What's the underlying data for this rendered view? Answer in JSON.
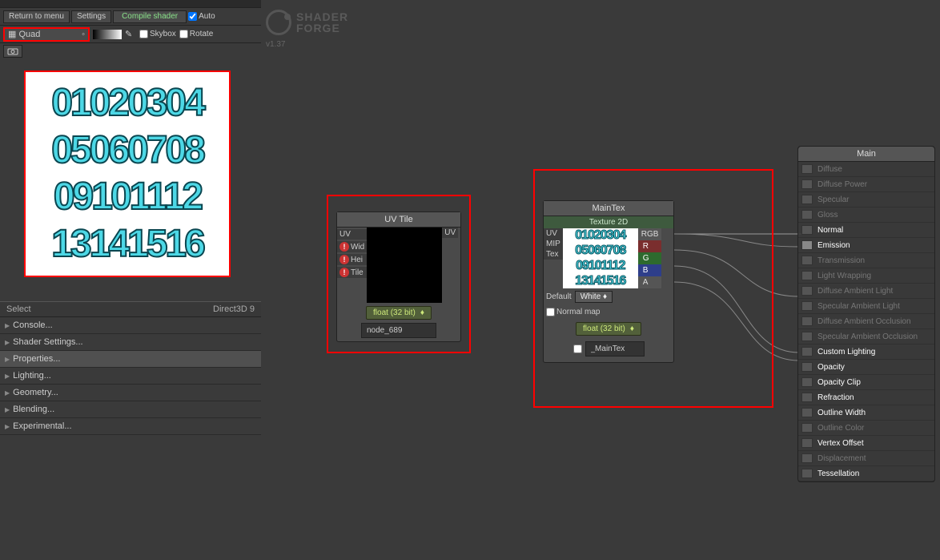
{
  "toolbar": {
    "return_menu": "Return to menu",
    "settings": "Settings",
    "compile": "Compile shader",
    "auto": "Auto",
    "quad": "Quad",
    "skybox": "Skybox",
    "rotate": "Rotate"
  },
  "logo": {
    "line1": "SHADER",
    "line2": "FORGE",
    "version": "v1.37"
  },
  "preview_rows": [
    "01020304",
    "05060708",
    "09101112",
    "13141516"
  ],
  "status": {
    "left": "Select",
    "right": "Direct3D 9"
  },
  "settings_list": [
    "Console...",
    "Shader Settings...",
    "Properties...",
    "Lighting...",
    "Geometry...",
    "Blending...",
    "Experimental..."
  ],
  "uvtile": {
    "title": "UV Tile",
    "ports_left": [
      "UV",
      "Wid",
      "Hei",
      "Tile"
    ],
    "port_right": "UV",
    "float_label": "float (32 bit)",
    "name": "node_689"
  },
  "maintex": {
    "title": "MainTex",
    "subtitle": "Texture 2D",
    "ports_left": [
      "UV",
      "MIP",
      "Tex"
    ],
    "ports_right": [
      "RGB",
      "R",
      "G",
      "B",
      "A"
    ],
    "preview_rows": [
      "01020304",
      "05060708",
      "09101112",
      "13141516"
    ],
    "default": "Default",
    "white": "White",
    "normal_map": "Normal map",
    "float_label": "float (32 bit)",
    "name": "_MainTex"
  },
  "main_panel": {
    "title": "Main",
    "items": [
      {
        "label": "Diffuse",
        "state": "disabled"
      },
      {
        "label": "Diffuse Power",
        "state": "disabled"
      },
      {
        "label": "Specular",
        "state": "disabled"
      },
      {
        "label": "Gloss",
        "state": "disabled"
      },
      {
        "label": "Normal",
        "state": "active"
      },
      {
        "label": "Emission",
        "state": "active connected"
      },
      {
        "label": "Transmission",
        "state": "disabled"
      },
      {
        "label": "Light Wrapping",
        "state": "disabled"
      },
      {
        "label": "Diffuse Ambient Light",
        "state": "disabled"
      },
      {
        "label": "Specular Ambient Light",
        "state": "disabled"
      },
      {
        "label": "Diffuse Ambient Occlusion",
        "state": "disabled"
      },
      {
        "label": "Specular Ambient Occlusion",
        "state": "disabled"
      },
      {
        "label": "Custom Lighting",
        "state": "active"
      },
      {
        "label": "Opacity",
        "state": "active"
      },
      {
        "label": "Opacity Clip",
        "state": "active"
      },
      {
        "label": "Refraction",
        "state": "active"
      },
      {
        "label": "Outline Width",
        "state": "active"
      },
      {
        "label": "Outline Color",
        "state": "disabled"
      },
      {
        "label": "Vertex Offset",
        "state": "active"
      },
      {
        "label": "Displacement",
        "state": "disabled"
      },
      {
        "label": "Tessellation",
        "state": "active"
      }
    ]
  }
}
